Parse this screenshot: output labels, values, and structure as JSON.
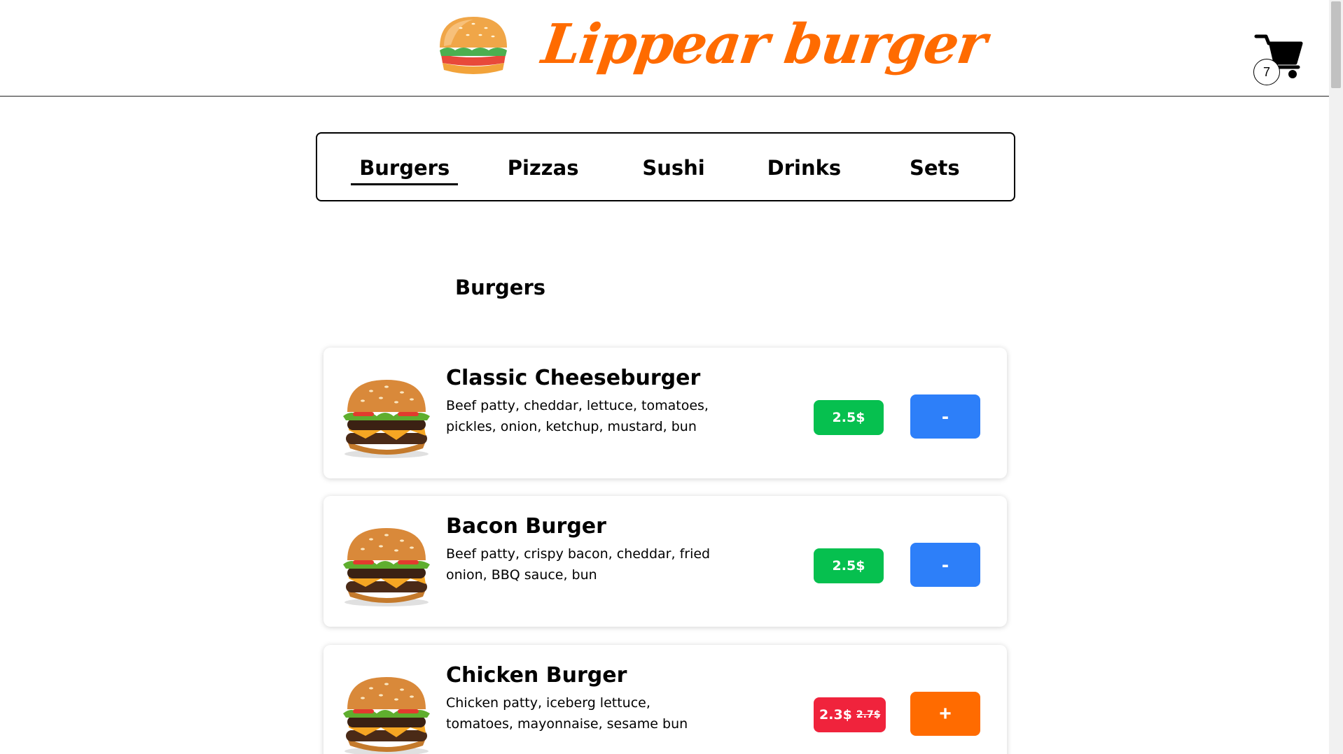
{
  "header": {
    "brand": "Lippear burger",
    "logo_icon": "burger-logo-icon",
    "cart_icon": "shopping-cart-icon",
    "cart_count": "7"
  },
  "tabs": [
    {
      "label": "Burgers",
      "active": true
    },
    {
      "label": "Pizzas",
      "active": false
    },
    {
      "label": "Sushi",
      "active": false
    },
    {
      "label": "Drinks",
      "active": false
    },
    {
      "label": "Sets",
      "active": false
    }
  ],
  "section": {
    "title": "Burgers"
  },
  "products": [
    {
      "name": "Classic Cheeseburger",
      "description": "Beef patty, cheddar, lettuce, tomatoes, pickles, onion, ketchup, mustard, bun",
      "price": "2.5$",
      "old_price": "",
      "price_color": "#06c04f",
      "action": "-",
      "action_color": "#2d7ff9"
    },
    {
      "name": "Bacon Burger",
      "description": "Beef patty, crispy bacon, cheddar, fried onion, BBQ sauce, bun",
      "price": "2.5$",
      "old_price": "",
      "price_color": "#06c04f",
      "action": "-",
      "action_color": "#2d7ff9"
    },
    {
      "name": "Chicken Burger",
      "description": "Chicken patty, iceberg lettuce, tomatoes, mayonnaise, sesame bun",
      "price": "2.3$",
      "old_price": "2.7$",
      "price_color": "#f0233c",
      "action": "+",
      "action_color": "#ff6b00"
    }
  ],
  "colors": {
    "brand": "#ff6b00",
    "price_regular": "#06c04f",
    "price_sale": "#f0233c",
    "remove_button": "#2d7ff9",
    "add_button": "#ff6b00"
  }
}
